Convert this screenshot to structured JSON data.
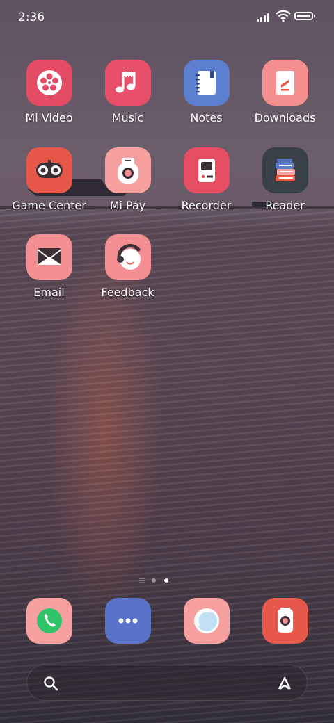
{
  "status_bar": {
    "time": "2:36"
  },
  "apps": [
    {
      "label": "Mi Video",
      "icon": "mi-video-icon",
      "color": "#e44c66"
    },
    {
      "label": "Music",
      "icon": "music-icon",
      "color": "#e84f6a"
    },
    {
      "label": "Notes",
      "icon": "notes-icon",
      "color": "#5b7fce"
    },
    {
      "label": "Downloads",
      "icon": "downloads-icon",
      "color": "#f58f8f"
    },
    {
      "label": "Game Center",
      "icon": "game-center-icon",
      "color": "#e5584a"
    },
    {
      "label": "Mi Pay",
      "icon": "mi-pay-icon",
      "color": "#f7a0a0"
    },
    {
      "label": "Recorder",
      "icon": "recorder-icon",
      "color": "#e54d62"
    },
    {
      "label": "Reader",
      "icon": "reader-icon",
      "color": "#3a4047"
    },
    {
      "label": "Email",
      "icon": "email-icon",
      "color": "#f38e92"
    },
    {
      "label": "Feedback",
      "icon": "feedback-icon",
      "color": "#f38e92"
    }
  ],
  "page_indicator": {
    "pages": 2,
    "current": 2
  },
  "dock": [
    {
      "icon": "phone-icon",
      "color": "#f7a0a0"
    },
    {
      "icon": "messaging-icon",
      "color": "#5b72c9"
    },
    {
      "icon": "browser-icon",
      "color": "#f7a0a0"
    },
    {
      "icon": "camera-icon",
      "color": "#e5584a"
    }
  ],
  "search_bar": {
    "left_icon": "search-icon",
    "right_icon": "assistant-icon"
  }
}
